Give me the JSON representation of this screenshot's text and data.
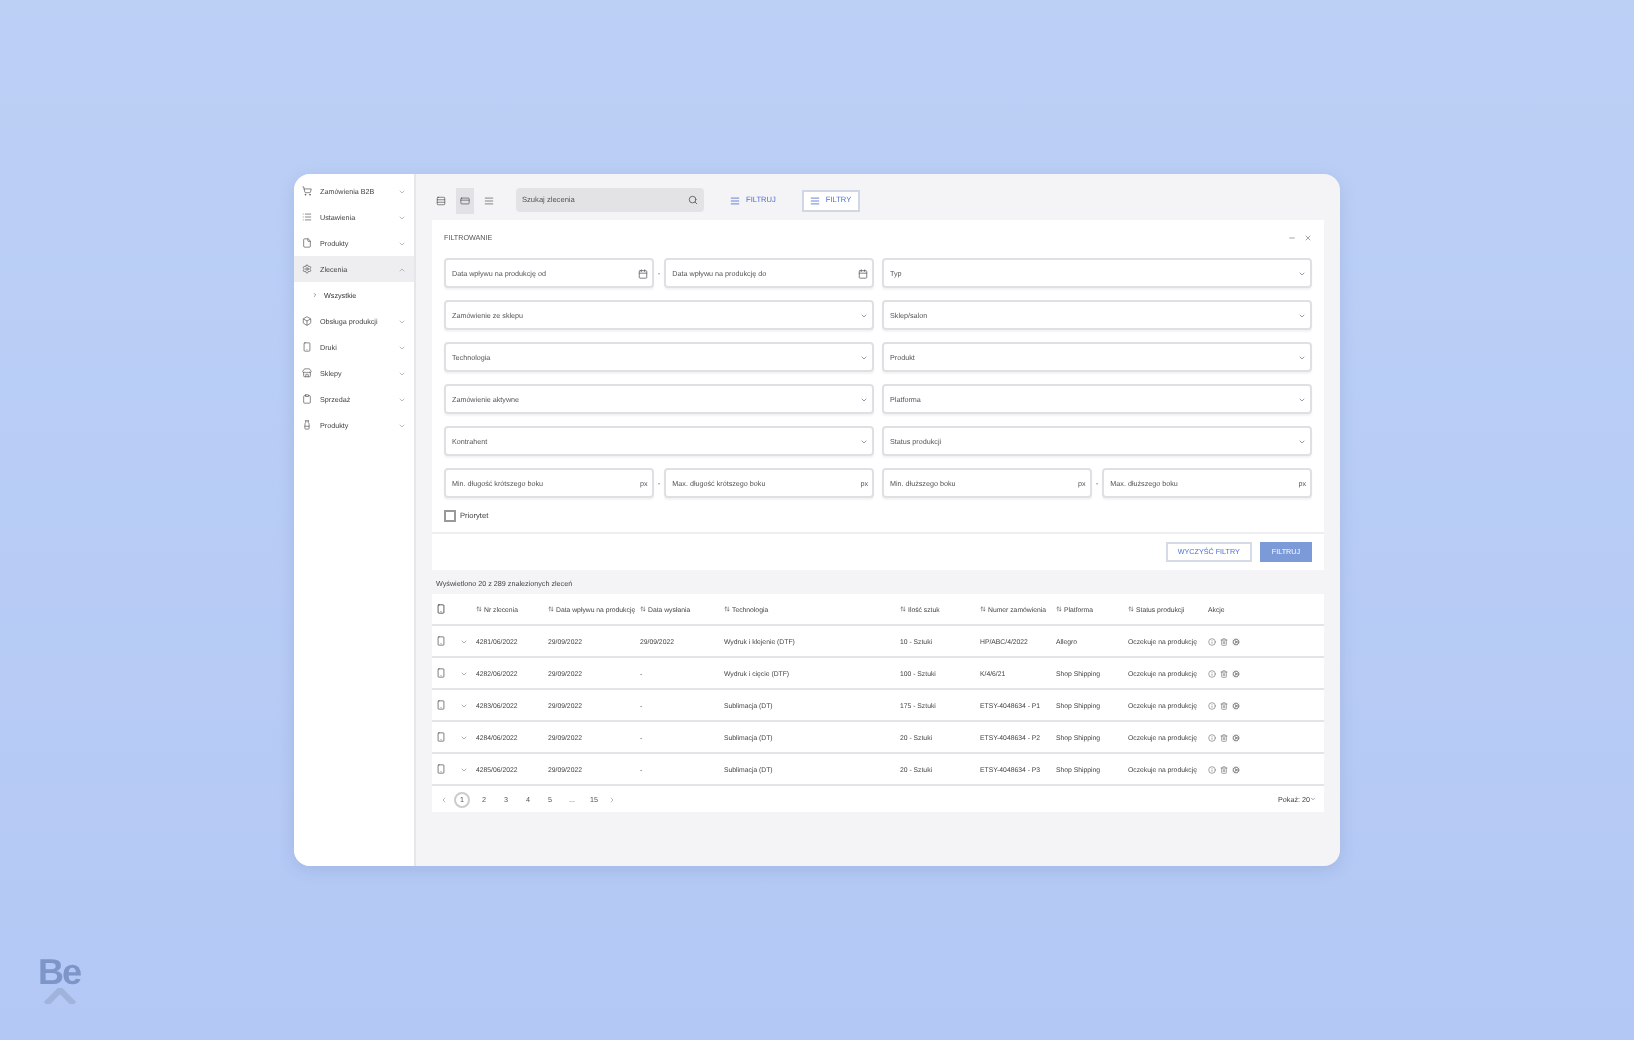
{
  "sidebar": {
    "items": [
      {
        "label": "Zamówienia B2B",
        "selected": false,
        "expanded": false
      },
      {
        "label": "Ustawienia",
        "selected": false,
        "expanded": false
      },
      {
        "label": "Produkty",
        "selected": false,
        "expanded": false
      },
      {
        "label": "Zlecenia",
        "selected": true,
        "expanded": true,
        "children": [
          {
            "label": "Wszystkie",
            "selected": true
          }
        ]
      },
      {
        "label": "Obsługa produkcji",
        "selected": false,
        "expanded": false
      },
      {
        "label": "Druki",
        "selected": false,
        "expanded": false
      },
      {
        "label": "Sklepy",
        "selected": false,
        "expanded": false
      },
      {
        "label": "Sprzedaż",
        "selected": false,
        "expanded": false
      },
      {
        "label": "Produkty",
        "selected": false,
        "expanded": false
      }
    ]
  },
  "toolbar": {
    "views": [
      {
        "selected": false
      },
      {
        "selected": true
      },
      {
        "selected": false
      }
    ],
    "search": {
      "placeholder": "Szukaj zlecenia"
    },
    "buttons": [
      {
        "label": "FILTRUJ",
        "selected": false
      },
      {
        "label": "FILTRY",
        "selected": true
      }
    ]
  },
  "filters": {
    "title": "FILTROWANIE",
    "separator": "-",
    "rows": [
      [
        [
          {
            "kind": "date",
            "placeholder": "Data wpływu na produkcję od"
          },
          {
            "kind": "date",
            "placeholder": "Data wpływu na produkcję do"
          }
        ],
        [
          {
            "kind": "select",
            "placeholder": "Typ"
          }
        ]
      ],
      [
        [
          {
            "kind": "select",
            "placeholder": "Zamówienie ze sklepu"
          }
        ],
        [
          {
            "kind": "select",
            "placeholder": "Sklep/salon"
          }
        ]
      ],
      [
        [
          {
            "kind": "select",
            "placeholder": "Technologia"
          }
        ],
        [
          {
            "kind": "select",
            "placeholder": "Produkt"
          }
        ]
      ],
      [
        [
          {
            "kind": "select",
            "placeholder": "Zamówienie aktywne"
          }
        ],
        [
          {
            "kind": "select",
            "placeholder": "Platforma"
          }
        ]
      ],
      [
        [
          {
            "kind": "select",
            "placeholder": "Kontrahent"
          }
        ],
        [
          {
            "kind": "select",
            "placeholder": "Status produkcji"
          }
        ]
      ],
      [
        [
          {
            "kind": "number",
            "placeholder": "Min. długość krótszego boku",
            "unit": "px"
          },
          {
            "kind": "number",
            "placeholder": "Max. długość krótszego boku",
            "unit": "px"
          }
        ],
        [
          {
            "kind": "number",
            "placeholder": "Min. dłuższego boku",
            "unit": "px"
          },
          {
            "kind": "number",
            "placeholder": "Max. dłuższego boku",
            "unit": "px"
          }
        ]
      ]
    ],
    "checkbox": {
      "label": "Priorytet",
      "checked": false
    },
    "clear_button": "WYCZYŚĆ FILTRY",
    "apply_button": "FILTRUJ"
  },
  "table": {
    "summary": "Wyświetlono 20 z 289 znalezionych zleceń",
    "columns": [
      "Nr zlecenia",
      "Data wpływu na produkcję",
      "Data wysłania",
      "Technologia",
      "Ilość sztuk",
      "Numer zamówienia",
      "Platforma",
      "Status produkcji",
      "Akcje"
    ],
    "rows": [
      {
        "checked": false,
        "cells": [
          "4281/06/2022",
          "29/09/2022",
          "29/09/2022",
          "Wydruk i klejenie (DTF)",
          "10 - Sztuki",
          "HP/ABC/4/2022",
          "Allegro",
          "Oczekuje na produkcję"
        ]
      },
      {
        "checked": false,
        "cells": [
          "4282/06/2022",
          "29/09/2022",
          "-",
          "Wydruk i cięcie (DTF)",
          "100 - Sztuki",
          "K/4/6/21",
          "Shop Shipping",
          "Oczekuje na produkcję"
        ]
      },
      {
        "checked": false,
        "cells": [
          "4283/06/2022",
          "29/09/2022",
          "-",
          "Sublimacja (DT)",
          "175 - Sztuki",
          "ETSY-4048634 - P1",
          "Shop Shipping",
          "Oczekuje na produkcję"
        ]
      },
      {
        "checked": false,
        "cells": [
          "4284/06/2022",
          "29/09/2022",
          "-",
          "Sublimacja (DT)",
          "20 - Sztuki",
          "ETSY-4048634 - P2",
          "Shop Shipping",
          "Oczekuje na produkcję"
        ]
      },
      {
        "checked": false,
        "cells": [
          "4285/06/2022",
          "29/09/2022",
          "-",
          "Sublimacja (DT)",
          "20 - Sztuki",
          "ETSY-4048634 - P3",
          "Shop Shipping",
          "Oczekuje na produkcję"
        ]
      }
    ],
    "pagination": {
      "pages": [
        {
          "label": "1",
          "selected": true
        },
        {
          "label": "2",
          "selected": false
        },
        {
          "label": "3",
          "selected": false
        },
        {
          "label": "4",
          "selected": false
        },
        {
          "label": "5",
          "selected": false
        },
        {
          "label": "...",
          "selected": false
        },
        {
          "label": "15",
          "selected": false
        }
      ]
    },
    "page_size": "Pokaż: 20"
  },
  "logo": {
    "text": "Be"
  }
}
